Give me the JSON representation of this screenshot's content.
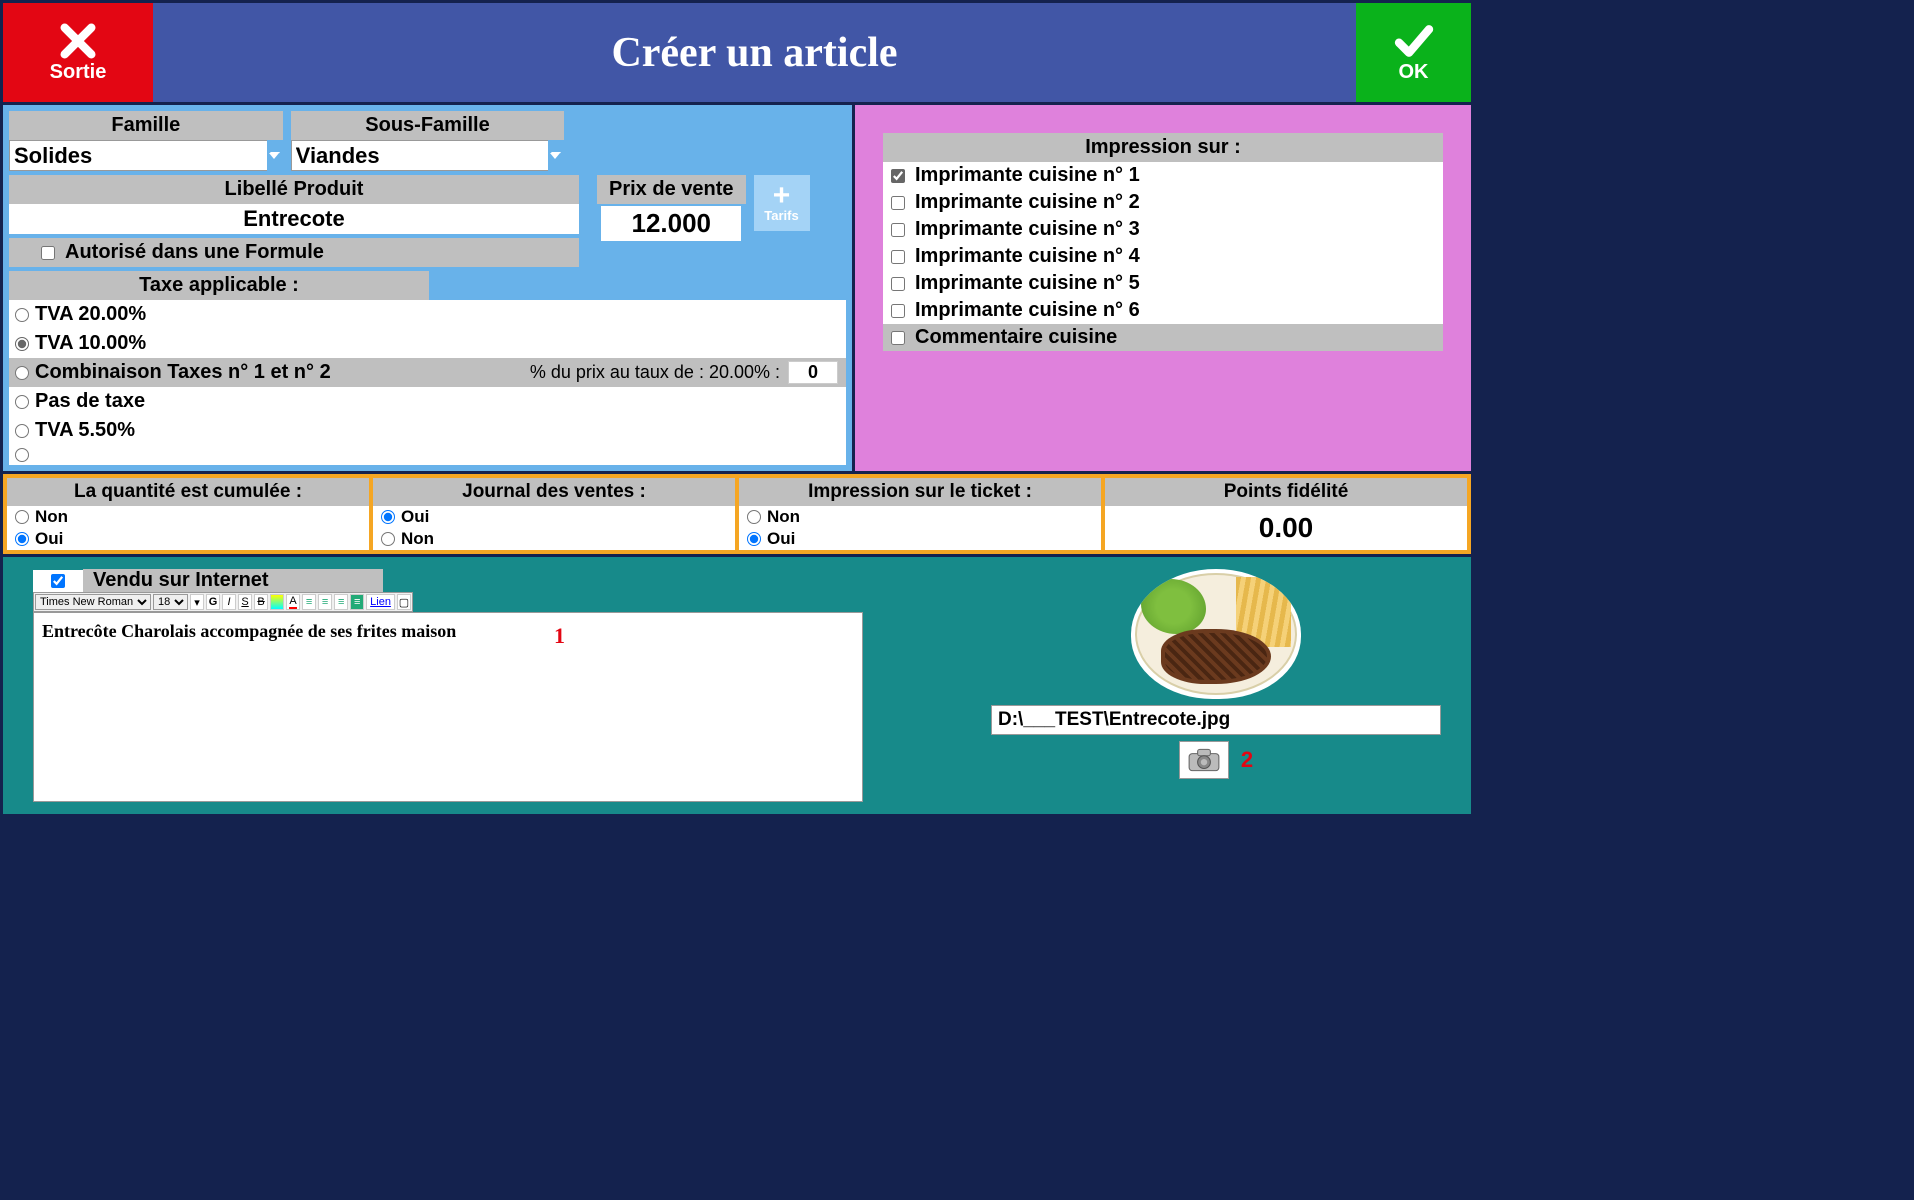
{
  "header": {
    "exit_label": "Sortie",
    "title": "Créer un article",
    "ok_label": "OK"
  },
  "left": {
    "famille_label": "Famille",
    "famille_value": "Solides",
    "sous_famille_label": "Sous-Famille",
    "sous_famille_value": "Viandes",
    "libelle_label": "Libellé Produit",
    "libelle_value": "Entrecote",
    "prix_label": "Prix de vente",
    "prix_value": "12.000",
    "tarifs_label": "Tarifs",
    "formule_label": "Autorisé dans une Formule",
    "taxe_label": "Taxe applicable :",
    "taxes": [
      {
        "label": "TVA 20.00%",
        "selected": false
      },
      {
        "label": "TVA 10.00%",
        "selected": true
      },
      {
        "label": "Combinaison Taxes n° 1 et n° 2",
        "selected": false,
        "extra": true
      },
      {
        "label": "Pas de taxe",
        "selected": false
      },
      {
        "label": "TVA 5.50%",
        "selected": false
      },
      {
        "label": "",
        "selected": false
      }
    ],
    "combo_label": "% du prix au taux de : 20.00% :",
    "combo_value": "0"
  },
  "right": {
    "imp_label": "Impression sur :",
    "printers": [
      {
        "label": "Imprimante cuisine n° 1",
        "checked": true
      },
      {
        "label": "Imprimante cuisine n° 2",
        "checked": false
      },
      {
        "label": "Imprimante cuisine n° 3",
        "checked": false
      },
      {
        "label": "Imprimante cuisine n° 4",
        "checked": false
      },
      {
        "label": "Imprimante cuisine n° 5",
        "checked": false
      },
      {
        "label": "Imprimante cuisine n° 6",
        "checked": false
      }
    ],
    "comment_label": "Commentaire cuisine"
  },
  "orange": {
    "qty_label": "La quantité est cumulée :",
    "qty_no": "Non",
    "qty_yes": "Oui",
    "journal_label": "Journal des ventes :",
    "ticket_label": "Impression sur le  ticket :",
    "points_label": "Points fidélité",
    "points_value": "0.00"
  },
  "teal": {
    "internet_label": "Vendu sur Internet",
    "font_name": "Times New Roman",
    "font_size": "18",
    "link_label": "Lien",
    "description": "Entrecôte Charolais accompagnée de ses frites maison",
    "marker1": "1",
    "img_path": "D:\\___TEST\\Entrecote.jpg",
    "marker2": "2"
  }
}
